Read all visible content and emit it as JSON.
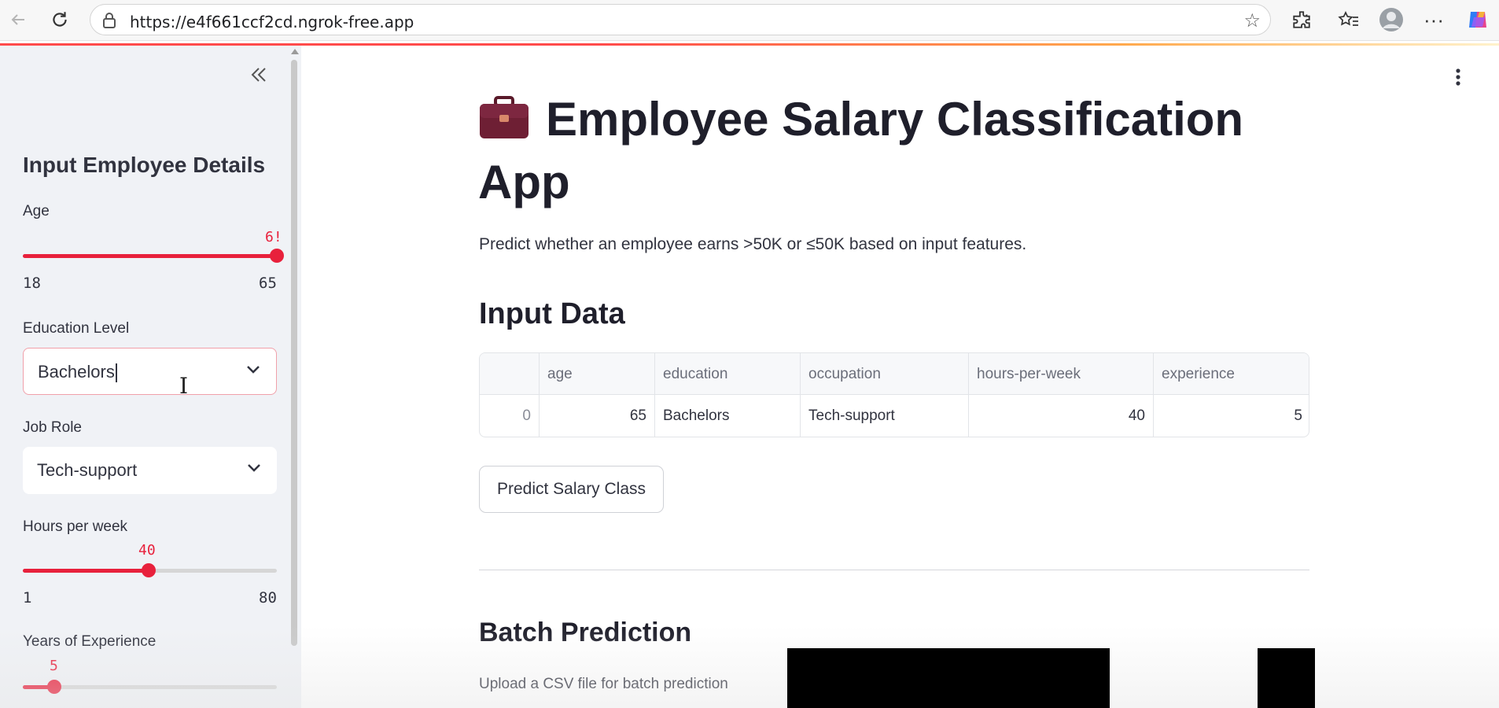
{
  "browser": {
    "url": "https://e4f661ccf2cd.ngrok-free.app"
  },
  "sidebar": {
    "title": "Input Employee Details",
    "age": {
      "label": "Age",
      "value_shown": "6!",
      "value": 65,
      "min": "18",
      "max": "65",
      "fraction": 1.0
    },
    "education": {
      "label": "Education Level",
      "value": "Bachelors"
    },
    "job_role": {
      "label": "Job Role",
      "value": "Tech-support"
    },
    "hours": {
      "label": "Hours per week",
      "value": "40",
      "min": "1",
      "max": "80",
      "fraction": 0.494
    },
    "experience": {
      "label": "Years of Experience",
      "value": "5",
      "fraction": 0.125
    }
  },
  "main": {
    "title": "Employee Salary Classification App",
    "title_line1": "Employee Salary Classification",
    "title_line2": "App",
    "subtitle": "Predict whether an employee earns >50K or ≤50K based on input features.",
    "input_heading": "Input Data",
    "table": {
      "columns": [
        "",
        "age",
        "education",
        "occupation",
        "hours-per-week",
        "experience"
      ],
      "rows": [
        [
          "0",
          "65",
          "Bachelors",
          "Tech-support",
          "40",
          "5"
        ]
      ]
    },
    "predict_button": "Predict Salary Class",
    "batch_heading": "Batch Prediction",
    "upload_label": "Upload a CSV file for batch prediction"
  },
  "colors": {
    "accent": "#e8213c",
    "sidebar_bg": "#f0f2f6",
    "text": "#31333f"
  },
  "icons": [
    "back-icon",
    "refresh-icon",
    "lock-icon",
    "star-icon",
    "extensions-icon",
    "favorites-icon",
    "profile-icon",
    "more-icon",
    "copilot-icon",
    "collapse-sidebar-icon",
    "chevron-down-icon",
    "briefcase-icon",
    "kebab-menu-icon",
    "text-cursor-icon"
  ]
}
